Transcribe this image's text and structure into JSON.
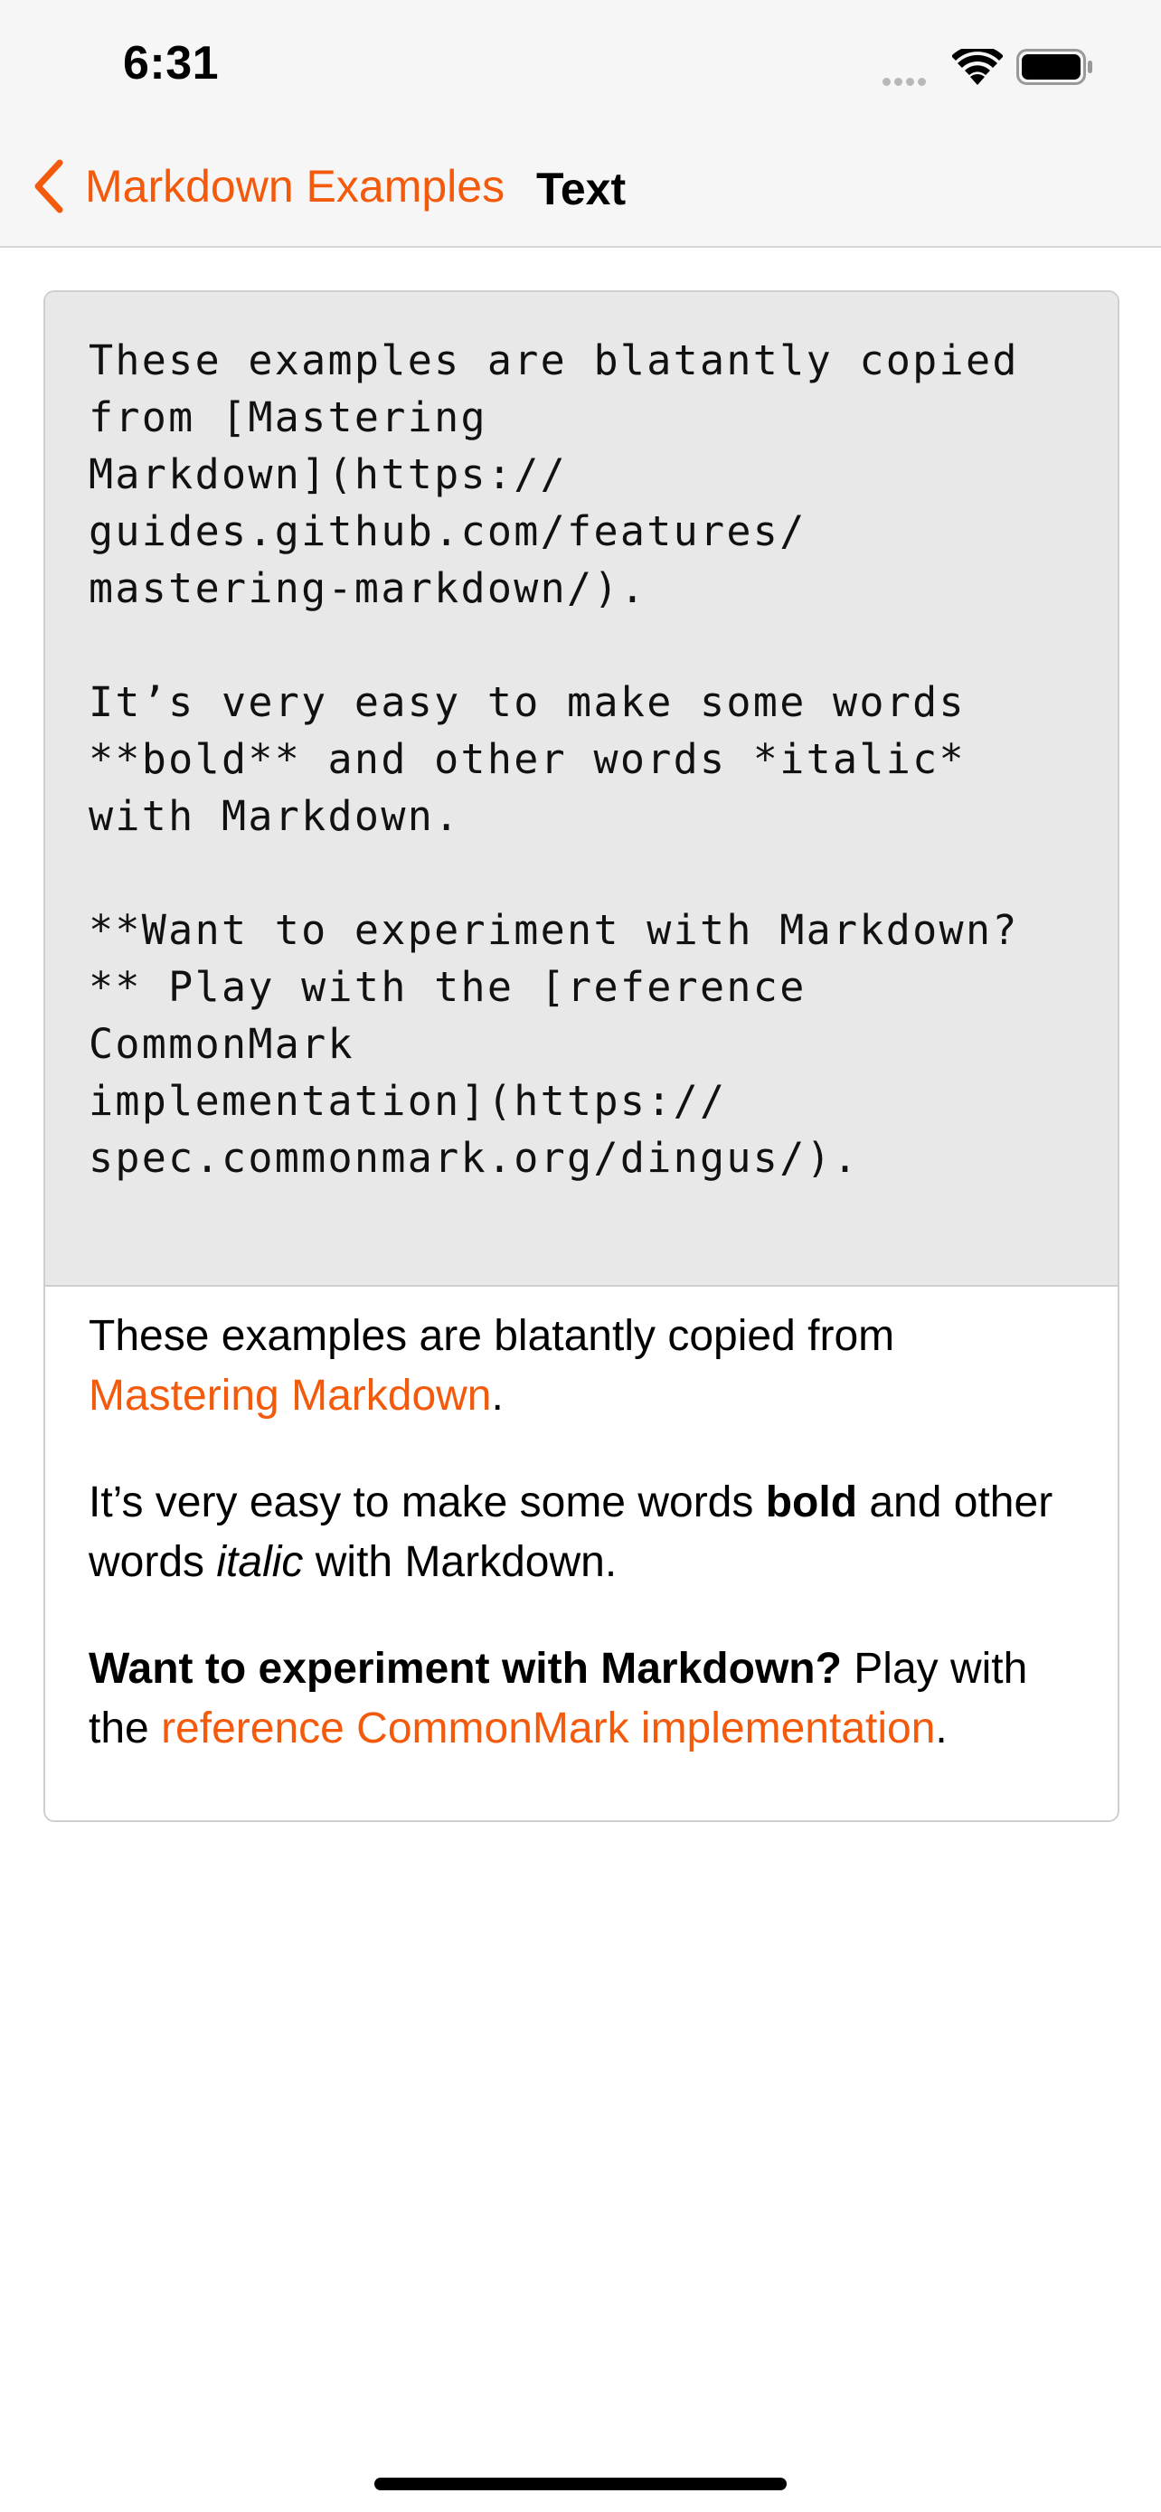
{
  "status_bar": {
    "time": "6:31"
  },
  "nav": {
    "back_label": "Markdown Examples",
    "title": "Text"
  },
  "colors": {
    "accent": "#f45a0c",
    "source_background": "#e8e8e8",
    "bar_background": "#f6f6f6"
  },
  "icons": {
    "back": "chevron-left-icon",
    "signal": "cellular-signal-icon",
    "wifi": "wifi-icon",
    "battery": "battery-icon"
  },
  "source": {
    "lines": [
      "These examples are blatantly copied",
      "from [Mastering",
      "Markdown](https://",
      "guides.github.com/features/",
      "mastering-markdown/).",
      "",
      "It’s very easy to make some words",
      "**bold** and other words *italic*",
      "with Markdown.",
      "",
      "**Want to experiment with Markdown?",
      "** Play with the [reference",
      "CommonMark",
      "implementation](https://",
      "spec.commonmark.org/dingus/)."
    ]
  },
  "rendered": {
    "p1": {
      "text": "These examples are blatantly copied from ",
      "link": "Mastering Markdown",
      "end": "."
    },
    "p2": {
      "before": "It’s very easy to make some words ",
      "bold": "bold",
      "middle": " and other words ",
      "italic": "italic",
      "after": " with Markdown."
    },
    "p3": {
      "bold": "Want to experiment with Markdown?",
      "text": " Play with the ",
      "link": "reference CommonMark implementation",
      "end": "."
    }
  }
}
